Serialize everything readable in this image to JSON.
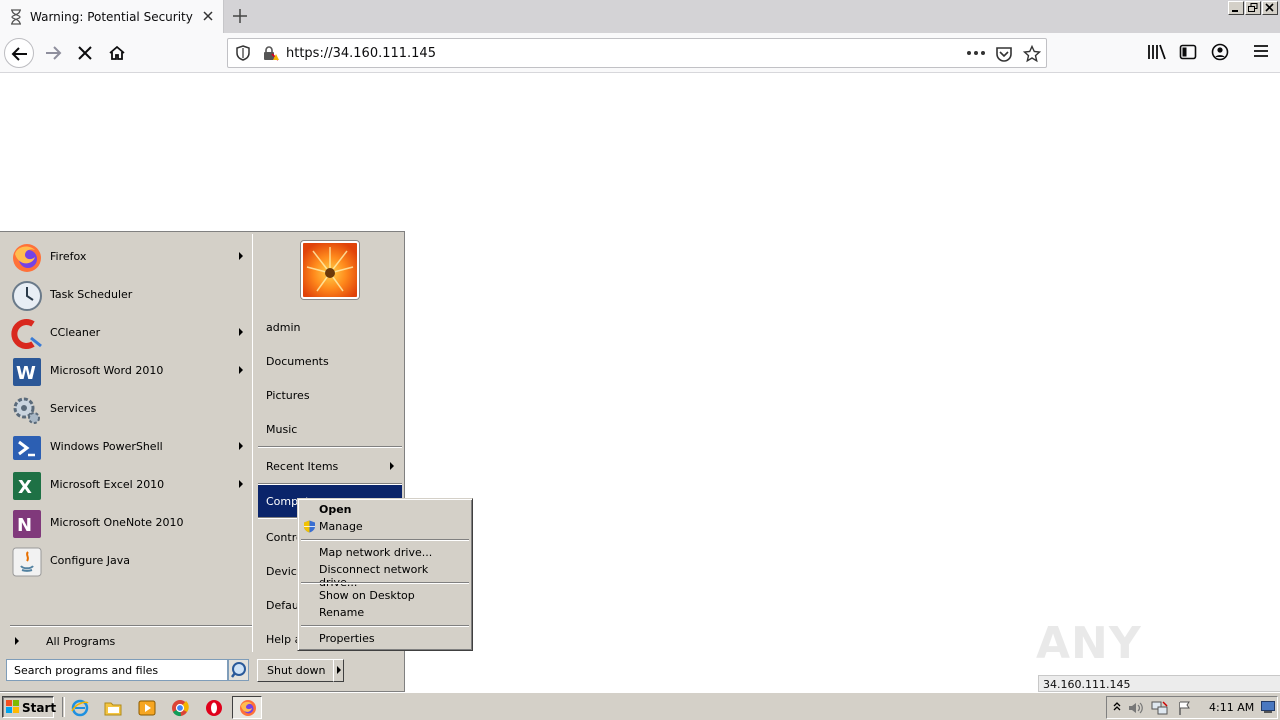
{
  "browser": {
    "tab_title": "Warning: Potential Security Risk Ahead",
    "url": "https://34.160.111.145"
  },
  "start_menu": {
    "programs": [
      {
        "label": "Firefox",
        "icon": "firefox-icon",
        "submenu": true
      },
      {
        "label": "Task Scheduler",
        "icon": "task-scheduler-icon",
        "submenu": false
      },
      {
        "label": "CCleaner",
        "icon": "ccleaner-icon",
        "submenu": true
      },
      {
        "label": "Microsoft Word 2010",
        "icon": "word-icon",
        "submenu": true
      },
      {
        "label": "Services",
        "icon": "services-icon",
        "submenu": false
      },
      {
        "label": "Windows PowerShell",
        "icon": "powershell-icon",
        "submenu": true
      },
      {
        "label": "Microsoft Excel 2010",
        "icon": "excel-icon",
        "submenu": true
      },
      {
        "label": "Microsoft OneNote 2010",
        "icon": "onenote-icon",
        "submenu": false
      },
      {
        "label": "Configure Java",
        "icon": "java-icon",
        "submenu": false
      }
    ],
    "all_programs": "All Programs",
    "search_placeholder": "Search programs and files",
    "places": {
      "user": "admin",
      "documents": "Documents",
      "pictures": "Pictures",
      "music": "Music",
      "recent": "Recent Items",
      "computer": "Computer",
      "control": "Control Panel",
      "devices": "Devices and Printers",
      "defaults": "Default Programs",
      "help": "Help and Support"
    },
    "shutdown": "Shut down"
  },
  "context_menu": {
    "open": "Open",
    "manage": "Manage",
    "map_drive": "Map network drive...",
    "disconnect_drive": "Disconnect network drive...",
    "show_desktop": "Show on Desktop",
    "rename": "Rename",
    "properties": "Properties"
  },
  "watermark": "ANY RUN",
  "status_url": "34.160.111.145",
  "taskbar": {
    "start": "Start",
    "clock": "4:11 AM"
  }
}
